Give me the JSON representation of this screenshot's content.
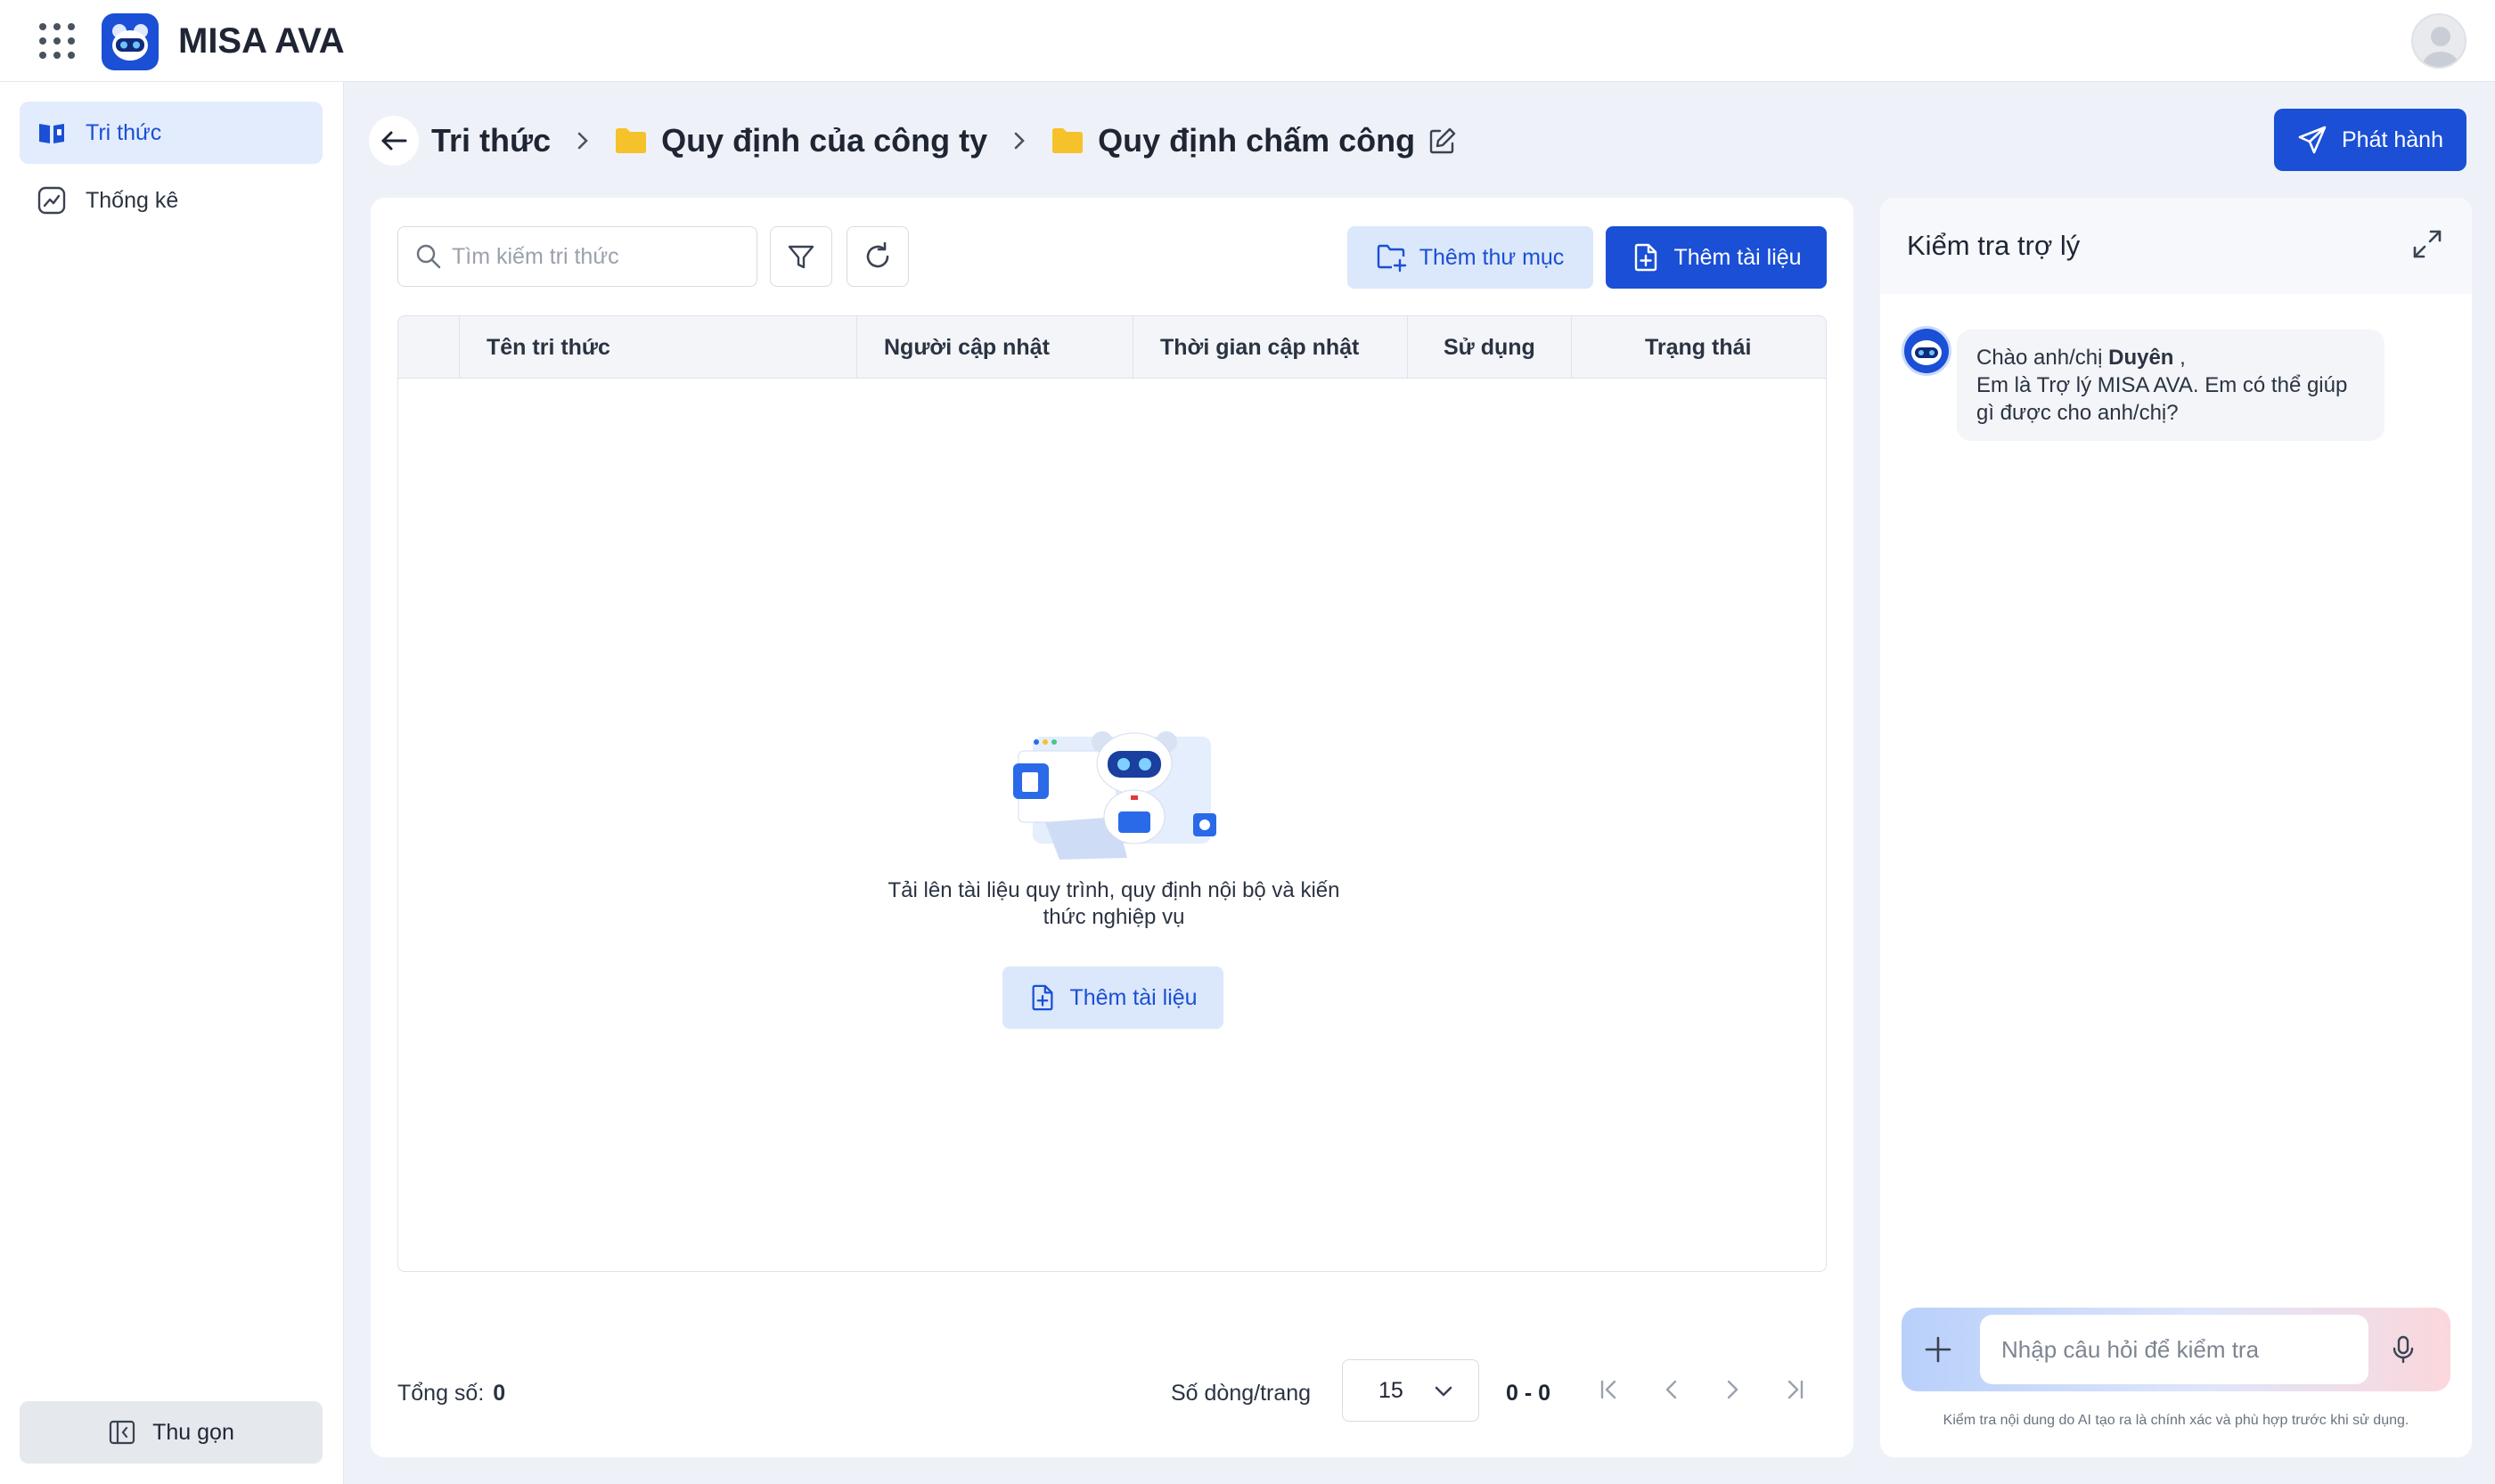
{
  "app": {
    "title": "MISA AVA"
  },
  "sidebar": {
    "items": [
      {
        "label": "Tri thức",
        "icon": "book-icon",
        "active": true
      },
      {
        "label": "Thống kê",
        "icon": "chart-icon",
        "active": false
      }
    ],
    "collapse_label": "Thu gọn"
  },
  "breadcrumb": {
    "items": [
      "Tri thức",
      "Quy định của công ty",
      "Quy định chấm công"
    ]
  },
  "header": {
    "publish_label": "Phát hành"
  },
  "toolbar": {
    "search_placeholder": "Tìm kiếm tri thức",
    "add_folder_label": "Thêm thư mục",
    "add_document_label": "Thêm tài liệu"
  },
  "table": {
    "columns": [
      "Tên tri thức",
      "Người cập nhật",
      "Thời gian cập nhật",
      "Sử dụng",
      "Trạng thái"
    ]
  },
  "empty": {
    "line1": "Tải lên tài liệu quy trình, quy định nội bộ và kiến",
    "line2": "thức nghiệp vụ",
    "button_label": "Thêm tài liệu"
  },
  "footer": {
    "total_label": "Tổng số:",
    "total_value": "0",
    "rows_label": "Số dòng/trang",
    "rows_value": "15",
    "range": "0 - 0"
  },
  "assistant": {
    "title": "Kiểm tra trợ lý",
    "greeting_prefix": "Chào anh/chị ",
    "user_name": "Duyên",
    "greeting_suffix": " ,",
    "message_rest": "Em là Trợ lý MISA AVA. Em có thể giúp gì được cho anh/chị?",
    "input_placeholder": "Nhập câu hỏi để kiểm tra",
    "disclaimer": "Kiểm tra nội dung do AI tạo ra là chính xác và phù hợp trước khi sử dụng."
  },
  "colors": {
    "primary": "#1a4fd6",
    "primary_light": "#dbe7fb",
    "folder": "#f5c22b",
    "background": "#eef2f8"
  }
}
